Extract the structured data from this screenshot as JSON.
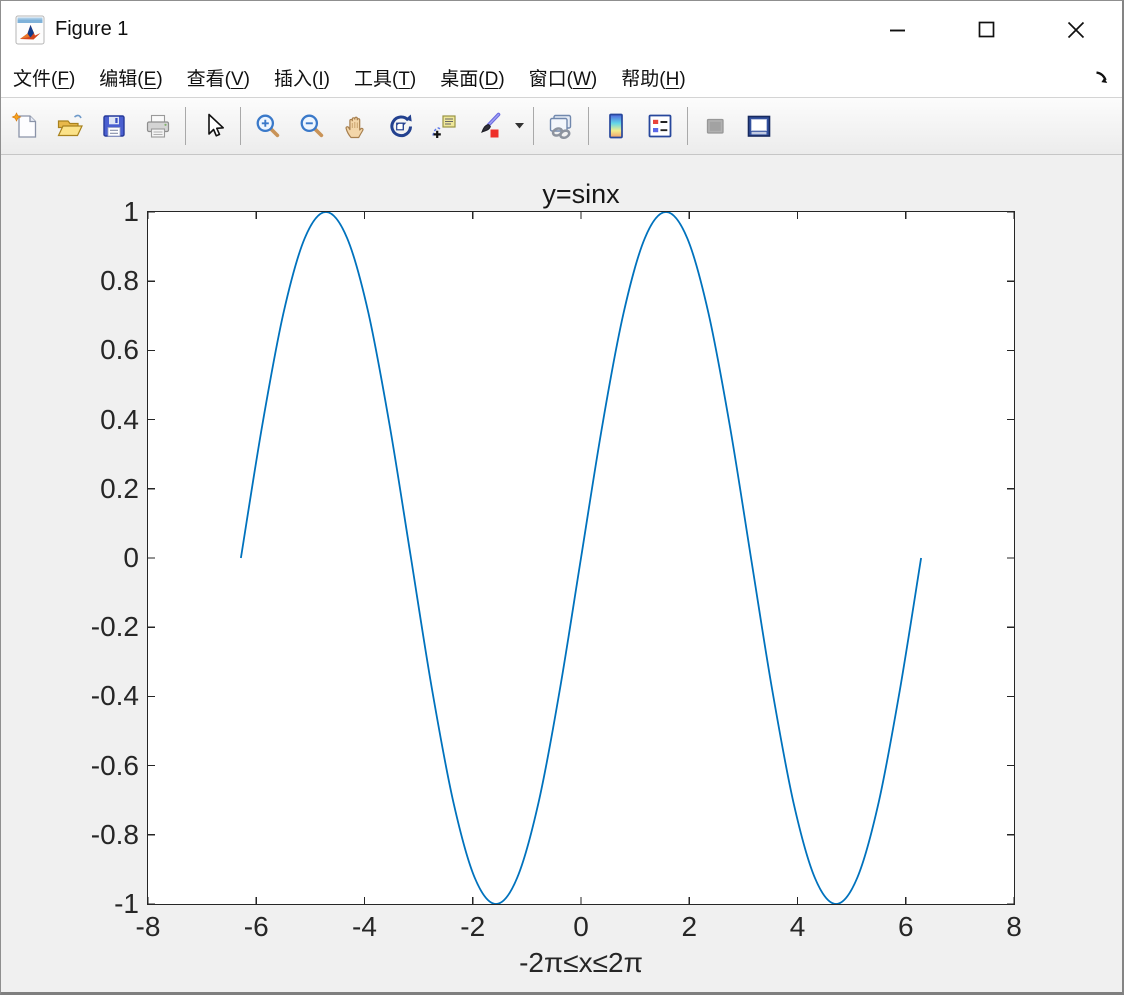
{
  "window": {
    "title": "Figure 1",
    "app_icon": "matlab-logo-icon",
    "controls": [
      {
        "key": "minimize",
        "icon": "minimize-icon"
      },
      {
        "key": "maximize",
        "icon": "maximize-icon"
      },
      {
        "key": "close",
        "icon": "close-icon"
      }
    ]
  },
  "menubar": {
    "items": [
      {
        "key": "file",
        "name": "文件",
        "mnemonic": "F"
      },
      {
        "key": "edit",
        "name": "编辑",
        "mnemonic": "E"
      },
      {
        "key": "view",
        "name": "查看",
        "mnemonic": "V"
      },
      {
        "key": "insert",
        "name": "插入",
        "mnemonic": "I"
      },
      {
        "key": "tools",
        "name": "工具",
        "mnemonic": "T"
      },
      {
        "key": "desktop",
        "name": "桌面",
        "mnemonic": "D"
      },
      {
        "key": "window",
        "name": "窗口",
        "mnemonic": "W"
      },
      {
        "key": "help",
        "name": "帮助",
        "mnemonic": "H"
      }
    ],
    "dock_icon": "dock-figure-icon"
  },
  "toolbar": {
    "buttons": [
      {
        "key": "new-figure",
        "icon": "new-file-icon",
        "enabled": true
      },
      {
        "key": "open-file",
        "icon": "open-folder-icon",
        "enabled": true
      },
      {
        "key": "save-figure",
        "icon": "save-icon",
        "enabled": true
      },
      {
        "key": "print",
        "icon": "printer-icon",
        "enabled": true
      },
      {
        "key": "edit-plot",
        "icon": "pointer-icon",
        "enabled": true
      },
      {
        "key": "zoom-in",
        "icon": "zoom-in-icon",
        "enabled": true
      },
      {
        "key": "zoom-out",
        "icon": "zoom-out-icon",
        "enabled": true
      },
      {
        "key": "pan",
        "icon": "hand-icon",
        "enabled": true
      },
      {
        "key": "rotate-3d",
        "icon": "rotate-3d-icon",
        "enabled": true
      },
      {
        "key": "data-cursor",
        "icon": "data-cursor-icon",
        "enabled": true
      },
      {
        "key": "brush-data",
        "icon": "brush-icon",
        "enabled": true
      },
      {
        "key": "brush-menu",
        "icon": "caret-down-icon",
        "enabled": true
      },
      {
        "key": "link-plot",
        "icon": "link-icon",
        "enabled": true
      },
      {
        "key": "insert-colorbar",
        "icon": "colorbar-icon",
        "enabled": true
      },
      {
        "key": "insert-legend",
        "icon": "legend-icon",
        "enabled": true
      },
      {
        "key": "hide-plot-tools",
        "icon": "hide-plot-tools-icon",
        "enabled": false
      },
      {
        "key": "show-plot-tools-dock",
        "icon": "show-plot-tools-icon",
        "enabled": true
      }
    ]
  },
  "figure": {
    "background": "#F0F0F0",
    "plot_background": "#FFFFFF"
  },
  "chart_data": {
    "type": "line",
    "title": "y=sinx",
    "xlabel": "-2π≤x≤2π",
    "ylabel": "",
    "xlim": [
      -8,
      8
    ],
    "ylim": [
      -1,
      1
    ],
    "x_ticks": [
      -8,
      -6,
      -4,
      -2,
      0,
      2,
      4,
      6,
      8
    ],
    "y_ticks": [
      -1,
      -0.8,
      -0.6,
      -0.4,
      -0.2,
      0,
      0.2,
      0.4,
      0.6,
      0.8,
      1
    ],
    "grid": false,
    "legend": "none",
    "axes_color": "#262626",
    "tick_direction": "in",
    "tick_length": 7,
    "series": [
      {
        "name": "y = sin(x)",
        "expression": "sin(x)",
        "x_range": [
          -6.2832,
          6.2832
        ],
        "color": "#0072BD",
        "line_width": 1.8,
        "points": [
          [
            -6.2832,
            0
          ],
          [
            -5.8905,
            0.3827
          ],
          [
            -5.4978,
            0.7071
          ],
          [
            -5.1051,
            0.9239
          ],
          [
            -4.7124,
            1
          ],
          [
            -4.3197,
            0.9239
          ],
          [
            -3.927,
            0.7071
          ],
          [
            -3.5343,
            0.3827
          ],
          [
            -3.1416,
            0
          ],
          [
            -2.7489,
            -0.3827
          ],
          [
            -2.3562,
            -0.7071
          ],
          [
            -1.9635,
            -0.9239
          ],
          [
            -1.5708,
            -1
          ],
          [
            -1.1781,
            -0.9239
          ],
          [
            -0.7854,
            -0.7071
          ],
          [
            -0.3927,
            -0.3827
          ],
          [
            0,
            0
          ],
          [
            0.3927,
            0.3827
          ],
          [
            0.7854,
            0.7071
          ],
          [
            1.1781,
            0.9239
          ],
          [
            1.5708,
            1
          ],
          [
            1.9635,
            0.9239
          ],
          [
            2.3562,
            0.7071
          ],
          [
            2.7489,
            0.3827
          ],
          [
            3.1416,
            0
          ],
          [
            3.5343,
            -0.3827
          ],
          [
            3.927,
            -0.7071
          ],
          [
            4.3197,
            -0.9239
          ],
          [
            4.7124,
            -1
          ],
          [
            5.1051,
            -0.9239
          ],
          [
            5.4978,
            -0.7071
          ],
          [
            5.8905,
            -0.3827
          ],
          [
            6.2832,
            0
          ]
        ]
      }
    ]
  }
}
